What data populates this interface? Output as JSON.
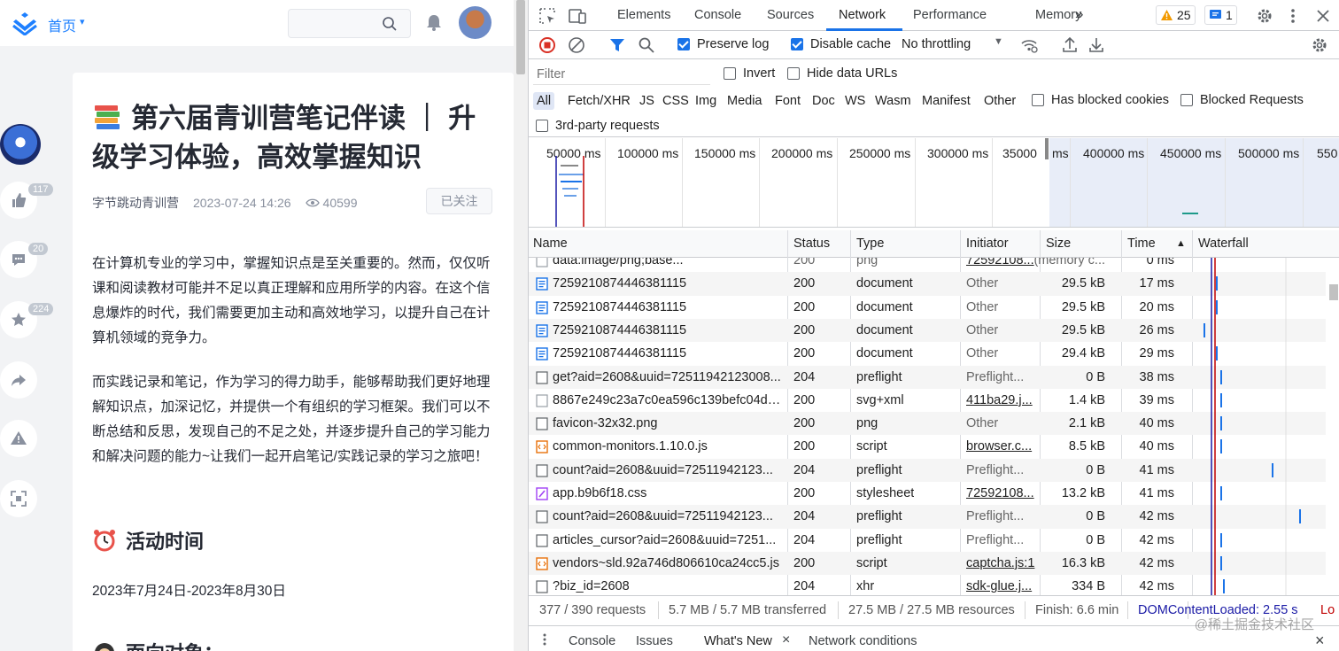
{
  "page": {
    "nav": {
      "home_label": "首页",
      "caret": "▾",
      "search_placeholder": ""
    },
    "actions": [
      {
        "name": "like",
        "count": "117"
      },
      {
        "name": "comment",
        "count": "20"
      },
      {
        "name": "collect",
        "count": "224"
      },
      {
        "name": "share",
        "count": ""
      },
      {
        "name": "report",
        "count": ""
      },
      {
        "name": "fullscreen",
        "count": ""
      }
    ],
    "article": {
      "title": "第六届青训营笔记伴读 ｜ 升级学习体验，高效掌握知识",
      "author": "字节跳动青训营",
      "date": "2023-07-24 14:26",
      "views": "40599",
      "follow_label": "已关注",
      "para1": "在计算机专业的学习中，掌握知识点是至关重要的。然而，仅仅听课和阅读教材可能并不足以真正理解和应用所学的内容。在这个信息爆炸的时代，我们需要更加主动和高效地学习，以提升自己在计算机领域的竞争力。",
      "para2": "而实践记录和笔记，作为学习的得力助手，能够帮助我们更好地理解知识点，加深记忆，并提供一个有组织的学习框架。我们可以不断总结和反思，发现自己的不足之处，并逐步提升自己的学习能力和解决问题的能力~让我们一起开启笔记/实践记录的学习之旅吧！",
      "h_time": "活动时间",
      "time_range": "2023年7月24日-2023年8月30日",
      "h_target": "面向对象："
    }
  },
  "devtools": {
    "tabs": [
      "Elements",
      "Console",
      "Sources",
      "Network",
      "Performance",
      "Memory"
    ],
    "active_tab": "Network",
    "more_tabs": "»",
    "warnings": "25",
    "messages": "1",
    "toolbar": {
      "preserve_log": "Preserve log",
      "preserve_log_checked": true,
      "disable_cache": "Disable cache",
      "disable_cache_checked": true,
      "throttling": "No throttling"
    },
    "filter": {
      "placeholder": "Filter",
      "invert": "Invert",
      "hide_data_urls": "Hide data URLs",
      "types": [
        "All",
        "Fetch/XHR",
        "JS",
        "CSS",
        "Img",
        "Media",
        "Font",
        "Doc",
        "WS",
        "Wasm",
        "Manifest",
        "Other"
      ],
      "active_type": "All",
      "has_blocked_cookies": "Has blocked cookies",
      "blocked_requests": "Blocked Requests",
      "third_party": "3rd-party requests"
    },
    "overview_ticks": [
      "50000 ms",
      "100000 ms",
      "150000 ms",
      "200000 ms",
      "250000 ms",
      "300000 ms",
      "35000",
      "ms",
      "400000 ms",
      "450000 ms",
      "500000 ms",
      "550"
    ],
    "columns": [
      "Name",
      "Status",
      "Type",
      "Initiator",
      "Size",
      "Time",
      "Waterfall"
    ],
    "sort_indicator": "▲",
    "rows": [
      {
        "icon": "image",
        "name": "data:image/png;base...",
        "status": "200",
        "type": "png",
        "initiator": "72592108...",
        "initiator_link": true,
        "size": "(memory c...",
        "time": "0 ms"
      },
      {
        "icon": "doc",
        "name": "7259210874446381115",
        "status": "200",
        "type": "document",
        "initiator": "Other",
        "initiator_link": false,
        "size": "29.5 kB",
        "time": "17 ms"
      },
      {
        "icon": "doc",
        "name": "7259210874446381115",
        "status": "200",
        "type": "document",
        "initiator": "Other",
        "initiator_link": false,
        "size": "29.5 kB",
        "time": "20 ms"
      },
      {
        "icon": "doc",
        "name": "7259210874446381115",
        "status": "200",
        "type": "document",
        "initiator": "Other",
        "initiator_link": false,
        "size": "29.5 kB",
        "time": "26 ms"
      },
      {
        "icon": "doc",
        "name": "7259210874446381115",
        "status": "200",
        "type": "document",
        "initiator": "Other",
        "initiator_link": false,
        "size": "29.4 kB",
        "time": "29 ms"
      },
      {
        "icon": "blank",
        "name": "get?aid=2608&uuid=72511942123008...",
        "status": "204",
        "type": "preflight",
        "initiator": "Preflight...",
        "initiator_link": false,
        "size": "0 B",
        "time": "38 ms"
      },
      {
        "icon": "svg",
        "name": "8867e249c23a7c0ea596c139befc04d7...",
        "status": "200",
        "type": "svg+xml",
        "initiator": "411ba29.j...",
        "initiator_link": true,
        "size": "1.4 kB",
        "time": "39 ms"
      },
      {
        "icon": "blank",
        "name": "favicon-32x32.png",
        "status": "200",
        "type": "png",
        "initiator": "Other",
        "initiator_link": false,
        "size": "2.1 kB",
        "time": "40 ms"
      },
      {
        "icon": "script",
        "name": "common-monitors.1.10.0.js",
        "status": "200",
        "type": "script",
        "initiator": "browser.c...",
        "initiator_link": true,
        "size": "8.5 kB",
        "time": "40 ms"
      },
      {
        "icon": "blank",
        "name": "count?aid=2608&uuid=72511942123...",
        "status": "204",
        "type": "preflight",
        "initiator": "Preflight...",
        "initiator_link": false,
        "size": "0 B",
        "time": "41 ms"
      },
      {
        "icon": "css",
        "name": "app.b9b6f18.css",
        "status": "200",
        "type": "stylesheet",
        "initiator": "72592108...",
        "initiator_link": true,
        "size": "13.2 kB",
        "time": "41 ms"
      },
      {
        "icon": "blank",
        "name": "count?aid=2608&uuid=72511942123...",
        "status": "204",
        "type": "preflight",
        "initiator": "Preflight...",
        "initiator_link": false,
        "size": "0 B",
        "time": "42 ms"
      },
      {
        "icon": "blank",
        "name": "articles_cursor?aid=2608&uuid=7251...",
        "status": "204",
        "type": "preflight",
        "initiator": "Preflight...",
        "initiator_link": false,
        "size": "0 B",
        "time": "42 ms"
      },
      {
        "icon": "script",
        "name": "vendors~sld.92a746d806610ca24cc5.js",
        "status": "200",
        "type": "script",
        "initiator": "captcha.js:1",
        "initiator_link": true,
        "size": "16.3 kB",
        "time": "42 ms"
      },
      {
        "icon": "blank",
        "name": "?biz_id=2608",
        "status": "204",
        "type": "xhr",
        "initiator": "sdk-glue.j...",
        "initiator_link": true,
        "size": "334 B",
        "time": "42 ms"
      }
    ],
    "status_bar": {
      "requests": "377 / 390 requests",
      "transferred": "5.7 MB / 5.7 MB transferred",
      "resources": "27.5 MB / 27.5 MB resources",
      "finish": "Finish: 6.6 min",
      "dcl": "DOMContentLoaded: 2.55 s",
      "load": "Lo"
    },
    "drawer_tabs": [
      "Console",
      "Issues",
      "What's New",
      "Network conditions"
    ],
    "drawer_close": "×",
    "watermark": "@稀土掘金技术社区",
    "colors": {
      "accent": "#1a73e8",
      "dcl": "#1a1aa6",
      "load": "#c00000"
    }
  }
}
